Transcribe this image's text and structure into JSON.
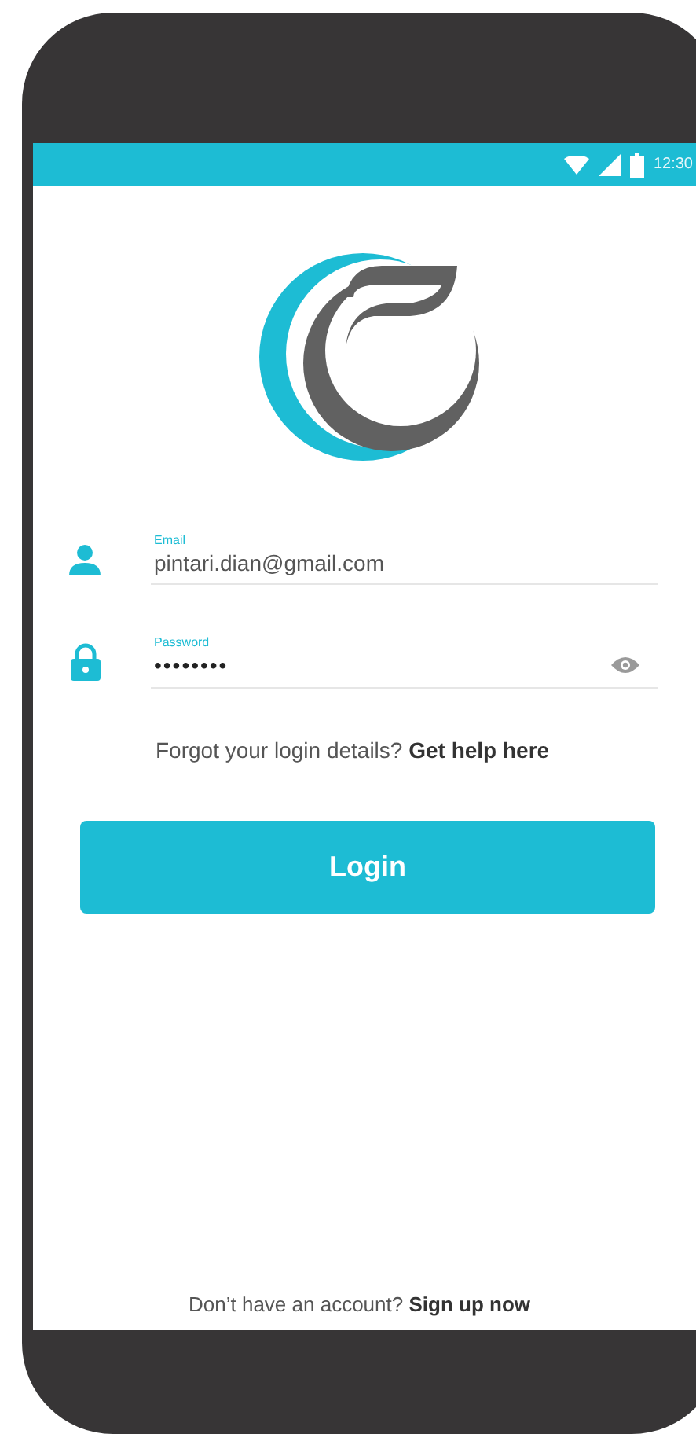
{
  "status_bar": {
    "time": "12:30"
  },
  "email_field": {
    "label": "Email",
    "value": "pintari.dian@gmail.com"
  },
  "password_field": {
    "label": "Password",
    "value": "••••••••"
  },
  "forgot": {
    "text": "Forgot your login details?",
    "link": "Get help here"
  },
  "login_button": {
    "label": "Login"
  },
  "signup": {
    "text": "Don’t have an account?",
    "link": "Sign up now"
  }
}
